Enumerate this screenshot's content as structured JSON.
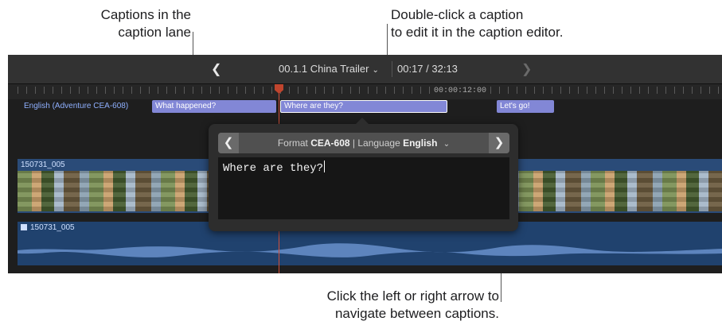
{
  "callouts": {
    "caption_lane": {
      "line1": "Captions in the",
      "line2": "caption lane"
    },
    "double_click": {
      "line1": "Double-click a caption",
      "line2": "to edit it in the caption editor."
    },
    "arrows": {
      "line1": "Click the left or right arrow to",
      "line2": "navigate between captions."
    }
  },
  "titlebar": {
    "project_name": "00.1.1 China Trailer",
    "timecode": "00:17 / 32:13",
    "prev_icon": "chevron-left-icon",
    "next_icon": "chevron-right-icon"
  },
  "ruler": {
    "timecode": "00:00:12:00"
  },
  "caption_lane": {
    "label": "English (Adventure CEA-608)",
    "captions": [
      "What happened?",
      "Where are they?",
      "Let's go!"
    ],
    "color": "#8287d6",
    "selected_index": 1
  },
  "video_clip": {
    "name": "150731_005",
    "color": "#2a4b78"
  },
  "audio_clip": {
    "name": "150731_005",
    "color": "#20426e"
  },
  "caption_editor": {
    "format_label": "Format",
    "format_value": "CEA-608",
    "separator": "|",
    "language_label": "Language",
    "language_value": "English",
    "text": "Where are they?"
  }
}
